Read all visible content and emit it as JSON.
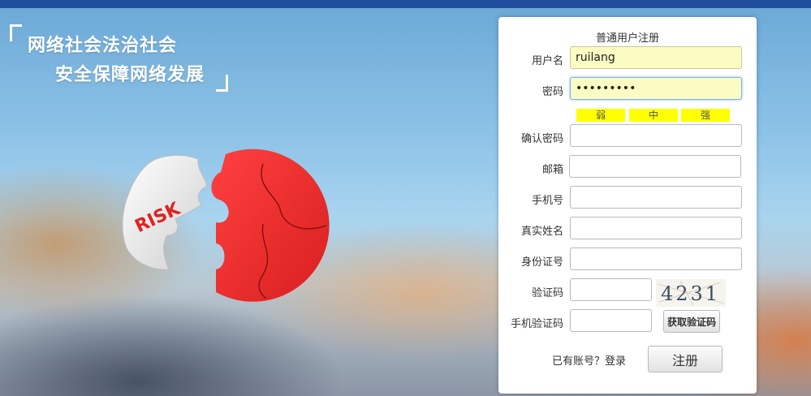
{
  "slogan": {
    "line1": "网络社会法治社会",
    "line2": "安全保障网络发展"
  },
  "puzzle": {
    "text": "RISK",
    "left_color": "#f2f2f2",
    "right_color": "#ee2b2b"
  },
  "form": {
    "title": "普通用户注册",
    "username_label": "用户名",
    "username_value": "ruilang",
    "password_label": "密码",
    "password_value": "•••••••••",
    "strength": {
      "weak": "弱",
      "medium": "中",
      "strong": "强"
    },
    "confirm_label": "确认密码",
    "email_label": "邮箱",
    "phone_label": "手机号",
    "realname_label": "真实姓名",
    "idcard_label": "身份证号",
    "captcha_label": "验证码",
    "captcha_text": "4231",
    "sms_label": "手机验证码",
    "get_code_button": "获取验证码",
    "has_account": "已有账号？登录",
    "register_button": "注册"
  },
  "colors": {
    "topbar": "#1f4c9c",
    "strength_bar": "#ffff00",
    "autofill": "#fbfcc3"
  }
}
